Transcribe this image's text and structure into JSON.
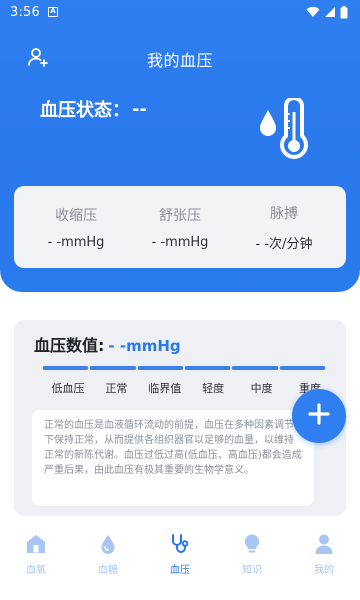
{
  "status_bar": {
    "time": "3:56",
    "notif_glyph": "A",
    "icons": [
      "wifi-icon",
      "signal-icon",
      "battery-icon"
    ]
  },
  "header": {
    "title": "我的血压",
    "left_icon": "user-add-icon"
  },
  "bp_status": {
    "label": "血压状态：",
    "value": "--",
    "icon": "thermometer-drop-icon"
  },
  "readings": [
    {
      "label": "收缩压",
      "value": "- -mmHg"
    },
    {
      "label": "舒张压",
      "value": "- -mmHg"
    },
    {
      "label": "脉搏",
      "value": "- -次/分钟"
    }
  ],
  "bp_value": {
    "title": "血压数值:",
    "reading": "- -mmHg"
  },
  "scale": {
    "labels": [
      "低血压",
      "正常",
      "临界值",
      "轻度",
      "中度",
      "重度"
    ]
  },
  "description": "正常的血压是血液循环流动的前提，血压在多种因素调节下保持正常，从而提供各组织器官以足够的血量，以维持正常的新陈代谢。血压过低过高(低血压、高血压)都会造成严重后果，由此血压有极其重要的生物学意义。",
  "fab": {
    "icon": "plus-icon"
  },
  "nav": [
    {
      "label": "血氧",
      "icon": "home-icon",
      "active": false
    },
    {
      "label": "血糖",
      "icon": "drops-icon",
      "active": false
    },
    {
      "label": "血压",
      "icon": "stethoscope-icon",
      "active": true
    },
    {
      "label": "知识",
      "icon": "bulb-icon",
      "active": false
    },
    {
      "label": "我的",
      "icon": "profile-icon",
      "active": false
    }
  ],
  "colors": {
    "primary": "#2f7ff0",
    "accent_text": "#2b78ee",
    "nav_inactive": "#a9c6f2",
    "card_bg": "#f2f3f5"
  }
}
